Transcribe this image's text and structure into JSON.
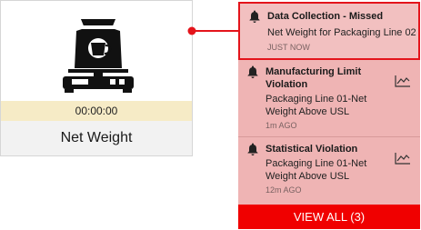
{
  "card": {
    "icon": "scale-with-bag-icon",
    "timer": "00:00:00",
    "label": "Net Weight"
  },
  "notifications": [
    {
      "title": "Data Collection - Missed",
      "body": "Net Weight for Packaging Line 02",
      "time": "JUST NOW",
      "icon": "bell-icon",
      "highlighted": true
    },
    {
      "title_line1": "Manufacturing Limit",
      "title_line2": "Violation",
      "body_line1": "Packaging Line 01-Net",
      "body_line2": "Weight Above USL",
      "time": "1m AGO",
      "icon": "bell-icon",
      "action_icon": "trend-chart-icon"
    },
    {
      "title": "Statistical Violation",
      "body_line1": "Packaging Line 01-Net",
      "body_line2": "Weight Above USL",
      "time": "12m AGO",
      "icon": "bell-icon",
      "action_icon": "trend-chart-icon"
    }
  ],
  "view_all_label": "VIEW ALL (3)",
  "colors": {
    "accent_red": "#f00000",
    "highlight_border": "#e4141b",
    "panel_bg": "#efb4b4",
    "timer_bg": "#f6ebc6"
  }
}
